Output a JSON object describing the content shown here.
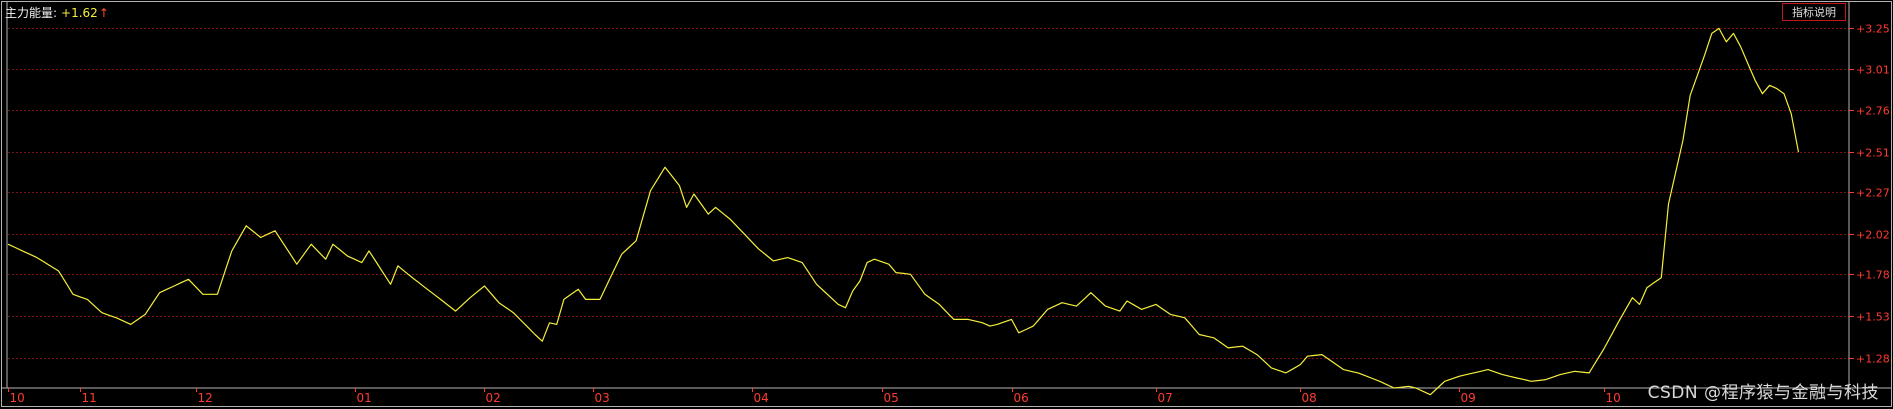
{
  "indicator": {
    "name": "主力能量:",
    "value": "+1.62",
    "arrow": "↑"
  },
  "buttons": {
    "explain_label": "指标说明"
  },
  "watermark": "CSDN @程序猿与金融与科技",
  "colors": {
    "background": "#000000",
    "line": "#f5ef3a",
    "grid": "#7a1010",
    "axis_text": "#ff3b30",
    "frame": "#b3b3b3"
  },
  "chart_data": {
    "type": "line",
    "ylim": [
      1.1,
      3.42
    ],
    "yticks": [
      "+3.25",
      "+3.01",
      "+2.76",
      "+2.51",
      "+2.27",
      "+2.02",
      "+1.78",
      "+1.53",
      "+1.28"
    ],
    "ytick_values": [
      3.25,
      3.01,
      2.76,
      2.51,
      2.27,
      2.02,
      1.78,
      1.53,
      1.28
    ],
    "x_count": 256,
    "xticks": [
      {
        "label": "10",
        "index": 0
      },
      {
        "label": "11",
        "index": 10
      },
      {
        "label": "12",
        "index": 26
      },
      {
        "label": "01",
        "index": 48
      },
      {
        "label": "02",
        "index": 66
      },
      {
        "label": "03",
        "index": 81
      },
      {
        "label": "04",
        "index": 103
      },
      {
        "label": "05",
        "index": 121
      },
      {
        "label": "06",
        "index": 139
      },
      {
        "label": "07",
        "index": 159
      },
      {
        "label": "08",
        "index": 179
      },
      {
        "label": "09",
        "index": 201
      },
      {
        "label": "10",
        "index": 221
      }
    ],
    "keypoints": [
      [
        0,
        1.96
      ],
      [
        4,
        1.88
      ],
      [
        7,
        1.8
      ],
      [
        9,
        1.66
      ],
      [
        11,
        1.63
      ],
      [
        13,
        1.55
      ],
      [
        15,
        1.52
      ],
      [
        17,
        1.48
      ],
      [
        19,
        1.54
      ],
      [
        21,
        1.67
      ],
      [
        23,
        1.71
      ],
      [
        25,
        1.75
      ],
      [
        27,
        1.66
      ],
      [
        29,
        1.66
      ],
      [
        31,
        1.92
      ],
      [
        33,
        2.07
      ],
      [
        35,
        2.0
      ],
      [
        37,
        2.04
      ],
      [
        40,
        1.84
      ],
      [
        42,
        1.96
      ],
      [
        44,
        1.87
      ],
      [
        45,
        1.96
      ],
      [
        47,
        1.89
      ],
      [
        49,
        1.85
      ],
      [
        50,
        1.92
      ],
      [
        53,
        1.72
      ],
      [
        54,
        1.83
      ],
      [
        56,
        1.76
      ],
      [
        59,
        1.66
      ],
      [
        62,
        1.56
      ],
      [
        64,
        1.64
      ],
      [
        66,
        1.71
      ],
      [
        68,
        1.61
      ],
      [
        70,
        1.55
      ],
      [
        73,
        1.42
      ],
      [
        74,
        1.38
      ],
      [
        75,
        1.49
      ],
      [
        76,
        1.48
      ],
      [
        77,
        1.63
      ],
      [
        79,
        1.69
      ],
      [
        80,
        1.63
      ],
      [
        82,
        1.63
      ],
      [
        85,
        1.9
      ],
      [
        87,
        1.98
      ],
      [
        89,
        2.28
      ],
      [
        91,
        2.42
      ],
      [
        93,
        2.31
      ],
      [
        94,
        2.18
      ],
      [
        95,
        2.26
      ],
      [
        97,
        2.14
      ],
      [
        98,
        2.18
      ],
      [
        100,
        2.11
      ],
      [
        102,
        2.02
      ],
      [
        104,
        1.93
      ],
      [
        106,
        1.86
      ],
      [
        108,
        1.88
      ],
      [
        110,
        1.85
      ],
      [
        112,
        1.72
      ],
      [
        114,
        1.64
      ],
      [
        115,
        1.6
      ],
      [
        116,
        1.58
      ],
      [
        117,
        1.68
      ],
      [
        118,
        1.74
      ],
      [
        119,
        1.85
      ],
      [
        120,
        1.87
      ],
      [
        122,
        1.84
      ],
      [
        123,
        1.79
      ],
      [
        125,
        1.78
      ],
      [
        127,
        1.66
      ],
      [
        129,
        1.6
      ],
      [
        131,
        1.51
      ],
      [
        133,
        1.51
      ],
      [
        135,
        1.49
      ],
      [
        136,
        1.47
      ],
      [
        137,
        1.48
      ],
      [
        139,
        1.51
      ],
      [
        140,
        1.43
      ],
      [
        142,
        1.47
      ],
      [
        144,
        1.57
      ],
      [
        146,
        1.61
      ],
      [
        148,
        1.59
      ],
      [
        150,
        1.67
      ],
      [
        152,
        1.59
      ],
      [
        154,
        1.56
      ],
      [
        155,
        1.62
      ],
      [
        157,
        1.57
      ],
      [
        159,
        1.6
      ],
      [
        161,
        1.54
      ],
      [
        163,
        1.52
      ],
      [
        165,
        1.42
      ],
      [
        167,
        1.4
      ],
      [
        169,
        1.34
      ],
      [
        171,
        1.35
      ],
      [
        173,
        1.3
      ],
      [
        175,
        1.22
      ],
      [
        177,
        1.19
      ],
      [
        179,
        1.24
      ],
      [
        180,
        1.29
      ],
      [
        182,
        1.3
      ],
      [
        183,
        1.27
      ],
      [
        185,
        1.21
      ],
      [
        187,
        1.19
      ],
      [
        190,
        1.14
      ],
      [
        192,
        1.1
      ],
      [
        194,
        1.11
      ],
      [
        195,
        1.1
      ],
      [
        197,
        1.06
      ],
      [
        199,
        1.14
      ],
      [
        201,
        1.17
      ],
      [
        203,
        1.19
      ],
      [
        205,
        1.21
      ],
      [
        207,
        1.18
      ],
      [
        209,
        1.16
      ],
      [
        211,
        1.14
      ],
      [
        213,
        1.15
      ],
      [
        215,
        1.18
      ],
      [
        217,
        1.2
      ],
      [
        219,
        1.19
      ],
      [
        221,
        1.33
      ],
      [
        223,
        1.49
      ],
      [
        225,
        1.64
      ],
      [
        226,
        1.6
      ],
      [
        227,
        1.7
      ],
      [
        229,
        1.76
      ],
      [
        230,
        2.2
      ],
      [
        232,
        2.58
      ],
      [
        233,
        2.85
      ],
      [
        234,
        2.97
      ],
      [
        235,
        3.09
      ],
      [
        236,
        3.22
      ],
      [
        237,
        3.25
      ],
      [
        238,
        3.17
      ],
      [
        239,
        3.22
      ],
      [
        240,
        3.14
      ],
      [
        241,
        3.04
      ],
      [
        242,
        2.94
      ],
      [
        243,
        2.86
      ],
      [
        244,
        2.91
      ],
      [
        245,
        2.89
      ],
      [
        246,
        2.86
      ],
      [
        247,
        2.74
      ],
      [
        248,
        2.51
      ]
    ]
  }
}
